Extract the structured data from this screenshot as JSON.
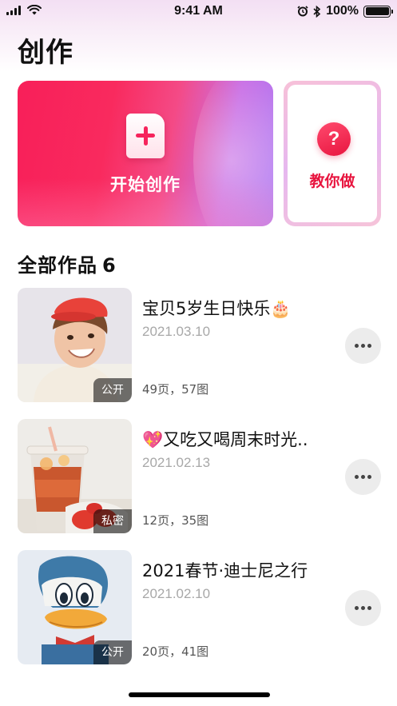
{
  "status_bar": {
    "time": "9:41 AM",
    "battery": "100%"
  },
  "page_title": "创作",
  "create_card": {
    "label": "开始创作"
  },
  "teach_card": {
    "label": "教你做",
    "icon_text": "?"
  },
  "section": {
    "title": "全部作品",
    "count": "6"
  },
  "works": [
    {
      "title": "宝贝5岁生日快乐🎂",
      "date": "2021.03.10",
      "meta": "49页，57图",
      "badge": "公开"
    },
    {
      "title": "💖又吃又喝周末时光..",
      "date": "2021.02.13",
      "meta": "12页，35图",
      "badge": "私密"
    },
    {
      "title": "2021春节·迪士尼之行",
      "date": "2021.02.10",
      "meta": "20页，41图",
      "badge": "公开"
    }
  ],
  "colors": {
    "accent": "#f6245c",
    "teach_accent": "#e8153f",
    "date_gray": "#a8a8a8"
  },
  "icons": [
    "signal-icon",
    "wifi-icon",
    "alarm-icon",
    "bluetooth-icon",
    "battery-icon",
    "plus-icon",
    "question-icon",
    "more-icon"
  ]
}
